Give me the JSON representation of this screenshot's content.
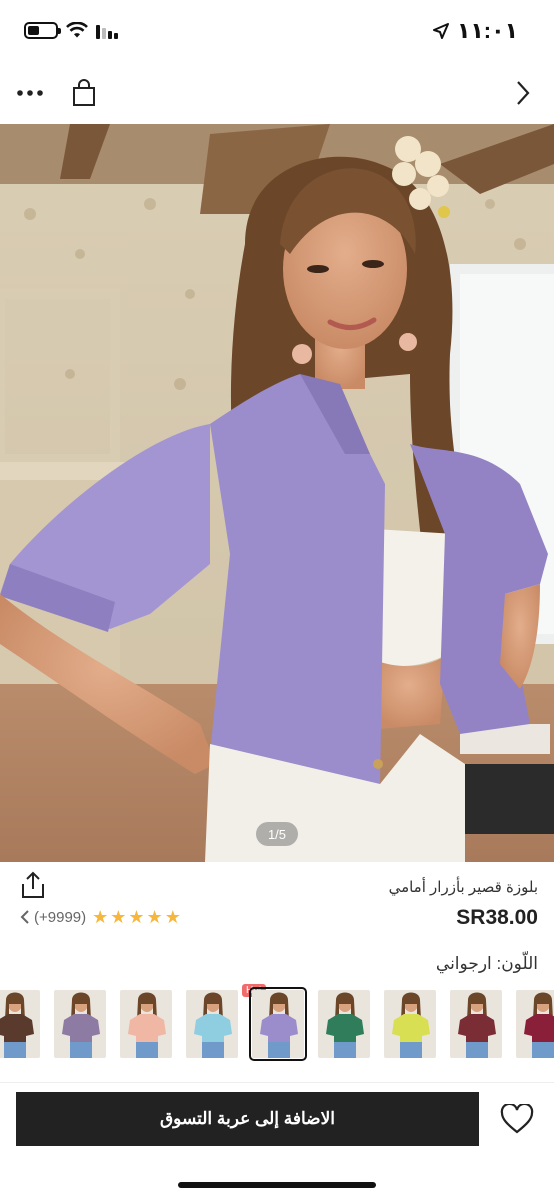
{
  "status_bar": {
    "time": "١١:٠١"
  },
  "nav": {
    "more_icon": "more-dots-icon",
    "bag_icon": "shopping-bag-icon",
    "forward_icon": "chevron-right-icon"
  },
  "hero": {
    "page_indicator": "1/5",
    "shirt_color": "#9b8ccb"
  },
  "product": {
    "title": "بلوزة قصير بأزرار أمامي",
    "price": "SR38.00",
    "rating_count": "(+9999)",
    "rating_stars": 5,
    "color_label": "اللّون: ارجواني"
  },
  "swatches": [
    {
      "color": "#5b3a2e",
      "selected": false
    },
    {
      "color": "#8d7ba3",
      "selected": false
    },
    {
      "color": "#f0b7a4",
      "selected": false
    },
    {
      "color": "#8fcde0",
      "selected": false
    },
    {
      "color": "#9b8ccb",
      "selected": true,
      "badge": "Hot"
    },
    {
      "color": "#2f7d5a",
      "selected": false
    },
    {
      "color": "#d9df52",
      "selected": false
    },
    {
      "color": "#7a2d35",
      "selected": false
    },
    {
      "color": "#8a1f3a",
      "selected": false
    }
  ],
  "actions": {
    "add_to_cart": "الاضافة إلى عربة التسوق"
  },
  "colors": {
    "star": "#f6b73c",
    "button_bg": "#222222",
    "badge": "#f06b6b"
  }
}
